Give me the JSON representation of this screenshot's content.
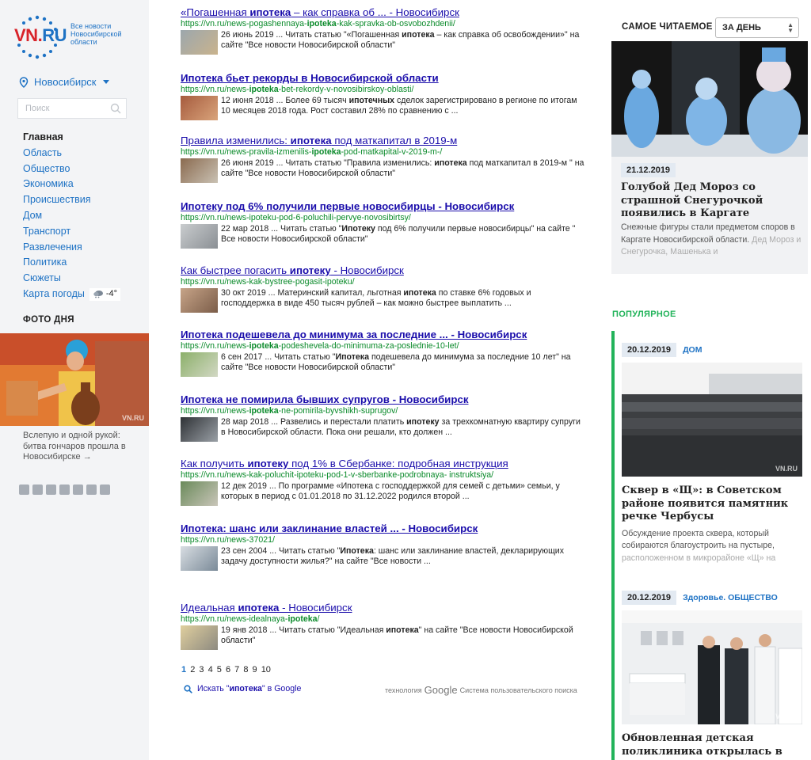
{
  "logo": {
    "vn": "VN",
    "dot": ".",
    "ru": "RU",
    "tagline": "Все новости Новосибирской области"
  },
  "city": "Новосибирск",
  "search_placeholder": "Поиск",
  "nav": [
    {
      "label": "Главная"
    },
    {
      "label": "Область"
    },
    {
      "label": "Общество"
    },
    {
      "label": "Экономика"
    },
    {
      "label": "Происшествия"
    },
    {
      "label": "Дом"
    },
    {
      "label": "Транспорт"
    },
    {
      "label": "Развлечения"
    },
    {
      "label": "Политика"
    },
    {
      "label": "Сюжеты"
    },
    {
      "label": "Карта погоды"
    }
  ],
  "weather_temp": "-4°",
  "photo_of_day": {
    "title": "ФОТО ДНЯ",
    "caption": "Вслепую и одной рукой: битва гончаров прошла в Новосибирске →"
  },
  "social_icons": [
    "vk-icon",
    "twitter-icon",
    "youtube-icon",
    "rss-icon",
    "odnoklassniki-icon",
    "telegram-icon",
    "mail-icon"
  ],
  "results": [
    {
      "title_parts": [
        "«Погашенная ",
        "ипотека",
        " – как справка об ... - Новосибирск"
      ],
      "url_parts": [
        "https://vn.ru/news-pogashennaya-",
        "ipoteka",
        "-kak-spravka-ob-osvobozhdenii/"
      ],
      "snippet_parts": [
        "26 июнь 2019 ... Читать статью \"«Погашенная ",
        "ипотека",
        " – как справка об освобождении»\" на сайте \"Все новости Новосибирской области\""
      ]
    },
    {
      "title_parts": [
        "Ипотека",
        " бьет рекорды в Новосибирской области",
        ""
      ],
      "url_parts": [
        "https://vn.ru/news-",
        "ipoteka",
        "-bet-rekordy-v-novosibirskoy-oblasti/"
      ],
      "snippet_parts": [
        "12 июня 2018 ... Более 69 тысяч ",
        "ипотечных",
        " сделок зарегистрировано в регионе по итогам 10 месяцев 2018 года. Рост составил 28% по сравнению с ..."
      ]
    },
    {
      "title_parts": [
        "Правила изменились: ",
        "ипотека",
        " под маткапитал в 2019-м"
      ],
      "url_parts": [
        "https://vn.ru/news-pravila-izmenilis-",
        "ipoteka",
        "-pod-matkapital-v-2019-m-/"
      ],
      "snippet_parts": [
        "26 июня 2019 ... Читать статью \"Правила изменились: ",
        "ипотека",
        " под маткапитал в 2019-м \" на сайте \"Все новости Новосибирской области\""
      ]
    },
    {
      "title_parts": [
        "Ипотеку",
        " под 6% получили первые новосибирцы - Новосибирск",
        ""
      ],
      "url_parts": [
        "https://vn.ru/news-ipoteku-pod-6-poluchili-pervye-novosibirtsy/",
        "",
        ""
      ],
      "snippet_parts": [
        "22 мар 2018 ... Читать статью \"",
        "Ипотеку",
        " под 6% получили первые новосибирцы\" на сайте \" Все новости Новосибирской области\""
      ]
    },
    {
      "title_parts": [
        "Как быстрее погасить ",
        "ипотеку",
        " - Новосибирск"
      ],
      "url_parts": [
        "https://vn.ru/news-kak-bystree-pogasit-ipoteku/",
        "",
        ""
      ],
      "snippet_parts": [
        "30 окт 2019 ... Материнский капитал, льготная ",
        "ипотека",
        " по ставке 6% годовых и господдержка в виде 450 тысяч рублей – как можно быстрее выплатить ..."
      ]
    },
    {
      "title_parts": [
        "Ипотека",
        " подешевела до минимума за последние ... - Новосибирск",
        ""
      ],
      "url_parts": [
        "https://vn.ru/news-",
        "ipoteka",
        "-podeshevela-do-minimuma-za-poslednie-10-let/"
      ],
      "snippet_parts": [
        "6 сен 2017 ... Читать статью \"",
        "Ипотека",
        " подешевела до минимума за последние 10 лет\" на сайте \"Все новости Новосибирской области\""
      ]
    },
    {
      "title_parts": [
        "Ипотека",
        " не помирила бывших супругов - Новосибирск",
        ""
      ],
      "url_parts": [
        "https://vn.ru/news-",
        "ipoteka",
        "-ne-pomirila-byvshikh-suprugov/"
      ],
      "snippet_parts": [
        "28 мар 2018 ... Развелись и перестали платить ",
        "ипотеку",
        " за трехкомнатную квартиру супруги в Новосибирской области. Пока они решали, кто должен ..."
      ]
    },
    {
      "title_parts": [
        "Как получить ",
        "ипотеку",
        " под 1% в Сбербанке: подробная инструкция"
      ],
      "url_parts": [
        "https://vn.ru/news-kak-poluchit-ipoteku-pod-1-v-sberbanke-podrobnaya- instruktsiya/",
        "",
        ""
      ],
      "snippet_parts": [
        "12 дек 2019 ... По программе «Ипотека с господдержкой для семей с детьми» семьи, у которых в период с 01.01.2018 по 31.12.2022 родился второй ...",
        "",
        ""
      ]
    },
    {
      "title_parts": [
        "Ипотека",
        ": шанс или заклинание властей ... - Новосибирск",
        ""
      ],
      "url_parts": [
        "https://vn.ru/news-37021/",
        "",
        ""
      ],
      "snippet_parts": [
        "23 сен 2004 ... Читать статью \"",
        "Ипотека",
        ": шанс или заклинание властей, декларирующих задачу доступности жилья?\" на сайте \"Все новости ..."
      ]
    },
    {
      "title_parts": [
        "Идеальная ",
        "ипотека",
        " - Новосибирск"
      ],
      "url_parts": [
        "https://vn.ru/news-idealnaya-",
        "ipoteka",
        "/"
      ],
      "snippet_parts": [
        "19 янв 2018 ... Читать статью \"Идеальная ",
        "ипотека",
        "\" на сайте \"Все новости Новосибирской области\""
      ]
    }
  ],
  "pagination": {
    "current": "1",
    "pages": [
      "2",
      "3",
      "4",
      "5",
      "6",
      "7",
      "8",
      "9",
      "10"
    ]
  },
  "google_search": {
    "prefix": "Искать \"",
    "query": "ипотека",
    "suffix": "\" в Google"
  },
  "google_tech": {
    "prefix": "технология",
    "brand": "Google",
    "suffix": "Система пользовательского поиска"
  },
  "most_read": {
    "title": "САМОЕ ЧИТАЕМОЕ",
    "period": "ЗА ДЕНЬ",
    "date": "21.12.2019",
    "headline": "Голубой Дед Мороз со страшной Снегурочкой появились в Каргате",
    "desc": "Снежные фигуры стали предметом споров в Каргате Новосибирской области.",
    "desc_fade": "Дед Мороз и Снегурочка, Машенька и"
  },
  "popular": {
    "title": "ПОПУЛЯРНОЕ",
    "items": [
      {
        "date": "20.12.2019",
        "rubric": "ДОМ",
        "headline": "Сквер в «Щ»: в Советском районе появится памятник речке Чербусы",
        "desc": "Обсуждение проекта сквера, который собираются благоустроить на пустыре,",
        "desc_fade": "расположенном в микрорайоне «Щ» на",
        "watermark": "VN.RU"
      },
      {
        "date": "20.12.2019",
        "rubric": "Здоровье. ОБЩЕСТВО",
        "headline": "Обновленная детская поликлиника открылась в рамках нацпроекта «Здравоохранение»",
        "desc": "",
        "desc_fade": "",
        "watermark": "VN.RU"
      }
    ]
  },
  "colors": {
    "accent": "#1e72c4",
    "brand_red": "#d8232a",
    "link": "#1a0dab",
    "url_green": "#0a8a2a",
    "popular_green": "#22b35a"
  }
}
